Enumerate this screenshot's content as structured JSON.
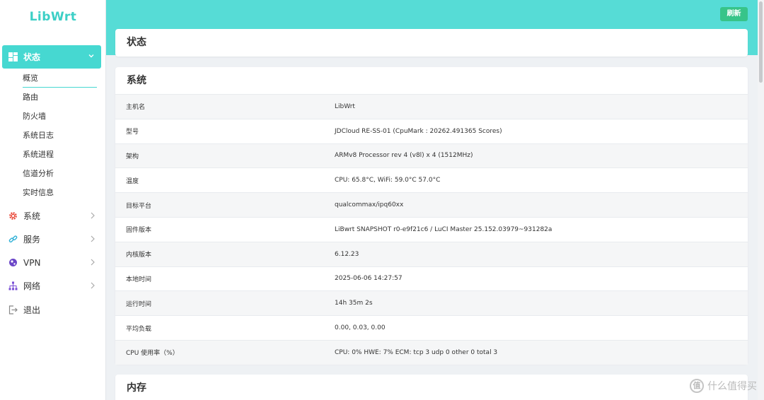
{
  "brand": {
    "logo": "LibWrt",
    "accent": "#46d8d1",
    "topbar_color": "#56dcd6"
  },
  "sidebar": {
    "active": {
      "label": "状态",
      "icon": "dashboard-icon"
    },
    "sub_items": [
      {
        "label": "概览"
      },
      {
        "label": "路由"
      },
      {
        "label": "防火墙"
      },
      {
        "label": "系统日志"
      },
      {
        "label": "系统进程"
      },
      {
        "label": "信道分析"
      },
      {
        "label": "实时信息"
      }
    ],
    "groups": [
      {
        "label": "系统",
        "icon": "gear-icon"
      },
      {
        "label": "服务",
        "icon": "link-icon"
      },
      {
        "label": "VPN",
        "icon": "globe-icon"
      },
      {
        "label": "网络",
        "icon": "network-icon"
      },
      {
        "label": "退出",
        "icon": "logout-icon"
      }
    ]
  },
  "toolbar": {
    "refresh_label": "刷新"
  },
  "page": {
    "title": "状态"
  },
  "system": {
    "title": "系统",
    "rows": [
      {
        "key": "主机名",
        "value": "LibWrt"
      },
      {
        "key": "型号",
        "value": "JDCloud RE-SS-01 (CpuMark : 20262.491365 Scores)"
      },
      {
        "key": "架构",
        "value": "ARMv8 Processor rev 4 (v8l) x 4 (1512MHz)"
      },
      {
        "key": "温度",
        "value": "CPU: 65.8°C, WiFi: 59.0°C 57.0°C"
      },
      {
        "key": "目标平台",
        "value": "qualcommax/ipq60xx"
      },
      {
        "key": "固件版本",
        "value": "LiBwrt SNAPSHOT r0-e9f21c6 / LuCI Master 25.152.03979~931282a"
      },
      {
        "key": "内核版本",
        "value": "6.12.23"
      },
      {
        "key": "本地时间",
        "value": "2025-06-06 14:27:57"
      },
      {
        "key": "运行时间",
        "value": "14h 35m 2s"
      },
      {
        "key": "平均负载",
        "value": "0.00, 0.03, 0.00"
      },
      {
        "key": "CPU 使用率（%）",
        "value": "CPU: 0% HWE: 7% ECM: tcp 3 udp 0 other 0 total 3"
      }
    ]
  },
  "memory": {
    "title": "内存"
  },
  "watermark": {
    "text": "什么值得买",
    "icon": "zhi-icon",
    "icon_text": "值"
  }
}
